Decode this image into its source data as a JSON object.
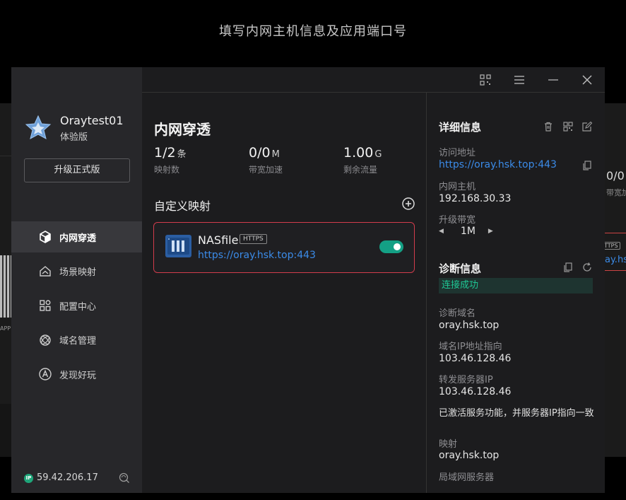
{
  "caption": "填写内网主机信息及应用端口号",
  "ghost": {
    "left_label": "APP",
    "right_number": "0/0",
    "right_label": "带宽加",
    "right_badge": "TTPS",
    "right_link": "ay.hsk"
  },
  "sidebar": {
    "user_name": "Oraytest01",
    "user_tier": "体验版",
    "upgrade_label": "升级正式版",
    "nav": [
      {
        "label": "内网穿透",
        "icon": "cube-icon",
        "active": true
      },
      {
        "label": "场景映射",
        "icon": "scene-icon",
        "active": false
      },
      {
        "label": "配置中心",
        "icon": "grid-icon",
        "active": false
      },
      {
        "label": "域名管理",
        "icon": "domain-icon",
        "active": false
      },
      {
        "label": "发现好玩",
        "icon": "compass-icon",
        "active": false
      }
    ],
    "ip_badge": "IP",
    "ip": "59.42.206.17"
  },
  "main": {
    "title": "内网穿透",
    "stats": [
      {
        "value": "1/2",
        "unit": "条",
        "label": "映射数"
      },
      {
        "value": "0/0",
        "unit": "M",
        "label": "带宽加速"
      },
      {
        "value": "1.00",
        "unit": "G",
        "label": "剩余流量"
      }
    ],
    "mapping_title": "自定义映射",
    "mapping": {
      "name": "NASfile",
      "protocol": "HTTPS",
      "url": "https://oray.hsk.top:443",
      "enabled": true
    }
  },
  "details": {
    "title": "详细信息",
    "access_label": "访问地址",
    "access_url": "https://oray.hsk.top:443",
    "host_label": "内网主机",
    "host_value": "192.168.30.33",
    "bandwidth_label": "升级带宽",
    "bandwidth_value": "1M",
    "diag_title": "诊断信息",
    "status": "连接成功",
    "diag_domain_label": "诊断域名",
    "diag_domain_value": "oray.hsk.top",
    "domain_ip_label": "域名IP地址指向",
    "domain_ip_value": "103.46.128.46",
    "forward_ip_label": "转发服务器IP",
    "forward_ip_value": "103.46.128.46",
    "note": "已激活服务功能，并服务器IP指向一致",
    "map_label": "映射",
    "map_value": "oray.hsk.top",
    "lan_label": "局域网服务器"
  },
  "colors": {
    "accent_link": "#3b8be8",
    "toggle_on": "#14a085",
    "card_border": "#d23c4c",
    "status_ok": "#1fc795"
  }
}
